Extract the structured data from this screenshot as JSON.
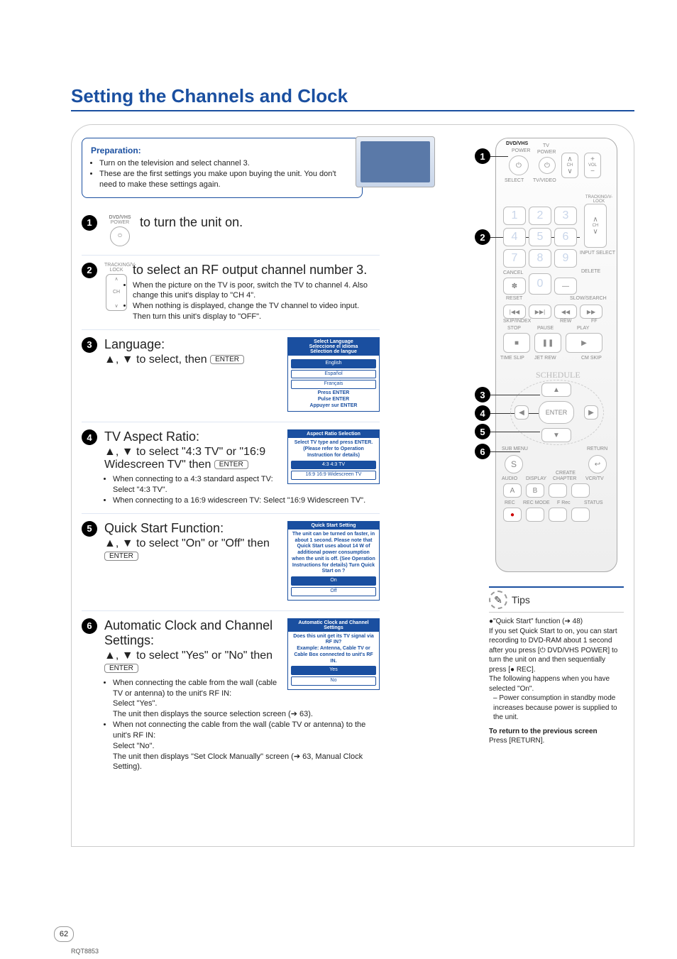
{
  "title": "Setting the Channels and Clock",
  "prep": {
    "heading": "Preparation:",
    "items": [
      "Turn on the television and select channel 3.",
      "These are the first settings you make upon buying the unit. You don't need to make these settings again."
    ]
  },
  "step1": {
    "labelTop": "DVD/VHS",
    "labelPower": "POWER",
    "text": "to turn the unit on."
  },
  "step2": {
    "labelTop": "TRACKING/V-LOCK",
    "chLabel": "CH",
    "text1": "to select an RF output channel number 3.",
    "b1": "When the picture on the TV is poor, switch the TV to channel 4. Also change this unit's display to \"CH 4\".",
    "b2": "When nothing is displayed, change the TV channel to video input. Then turn this unit's display to \"OFF\"."
  },
  "step3": {
    "title": "Language:",
    "text": " to select, then ",
    "enter": "ENTER",
    "osdHead": "Select Language\nSeleccione el idioma\nSélection de langue",
    "osdOpts": [
      "English",
      "Español",
      "Français"
    ],
    "osdFoot": "Press ENTER\nPulse ENTER\nAppuyer sur ENTER"
  },
  "step4": {
    "title": "TV Aspect Ratio:",
    "text": " to select \"4:3 TV\" or \"16:9 Widescreen TV\" then ",
    "enter": "ENTER",
    "b1": "When connecting to a 4:3 standard aspect TV: Select \"4:3 TV\".",
    "b2": "When connecting to a 16:9 widescreen TV: Select \"16:9 Widescreen TV\".",
    "osdHead": "Aspect Ratio Selection",
    "osdBody": "Select TV type  and press ENTER.\n(Please refer to Operation Instruction for details)",
    "osdOpts": [
      "4:3   4:3 TV",
      "16:9  16:9 Widescreen TV"
    ]
  },
  "step5": {
    "title": "Quick Start Function:",
    "text": " to select \"On\" or \"Off\"  then ",
    "enter": "ENTER",
    "osdHead": "Quick Start Setting",
    "osdBody": "The unit can be turned on faster, in about 1 second. Please note that Quick Start uses about 14 W of additional power consumption when the unit is off. (See Operation Instructions for details) Turn Quick Start on ?",
    "osdOpts": [
      "On",
      "Off"
    ]
  },
  "step6": {
    "title": "Automatic Clock and Channel Settings:",
    "text": " to select \"Yes\" or \"No\" then ",
    "enter": "ENTER",
    "b1": "When connecting the cable from the wall (cable TV or antenna) to the unit's RF IN:\nSelect \"Yes\".\nThe unit then displays the source selection screen (➔ 63).",
    "b2": "When not connecting the cable from the wall (cable TV or antenna) to the unit's RF IN:\nSelect \"No\".\nThe unit then displays \"Set Clock Manually\" screen (➔ 63, Manual Clock Setting).",
    "osdHead": "Automatic Clock and Channel Settings",
    "osdBody": "Does this unit get its TV signal via RF IN?\nExample: Antenna, Cable TV or Cable Box connected to unit's RF IN.",
    "osdOpts": [
      "Yes",
      "No"
    ]
  },
  "tips": {
    "title": "Tips",
    "b1": "\"Quick Start\" function (➔ 48)\nIf you set Quick Start to on, you can start recording to DVD-RAM about 1 second after you press [⏻ DVD/VHS POWER] to turn the unit on and then sequentially press [● REC].\nThe following happens when you have selected \"On\".",
    "sub1": "– Power consumption in standby mode increases because power is supplied to the unit.",
    "ret": "To return to the previous screen",
    "retBody": "Press [RETURN]."
  },
  "remote": {
    "dvdvhs": "DVD/VHS",
    "power": "POWER",
    "tv": "TV",
    "tvpower": "POWER",
    "dvdvhsTvLabel": "DVD/VHS  TV",
    "select": "SELECT",
    "tvvideo": "TV/VIDEO",
    "ch": "CH",
    "vol": "VOL",
    "track": "TRACKING/V-LOCK",
    "inputsel": "INPUT SELECT",
    "cancel": "CANCEL",
    "reset": "RESET",
    "delete": "DELETE",
    "slow": "SLOW/SEARCH",
    "skip": "SKIP/INDEX",
    "rew": "REW",
    "ff": "FF",
    "stop": "STOP",
    "pause": "PAUSE",
    "play": "PLAY",
    "timeslip": "TIME SLIP",
    "jetrew": "JET REW",
    "cmskip": "CM SKIP",
    "schedule": "SCHEDULE",
    "enter": "ENTER",
    "submenu": "SUB MENU",
    "return": "RETURN",
    "audio": "AUDIO",
    "display": "DISPLAY",
    "chapter": "CHAPTER",
    "create": "CREATE",
    "vcritv": "VCR/TV",
    "rec": "REC",
    "recmode": "REC MODE",
    "frec": "F Rec",
    "status": "STATUS",
    "num": [
      "1",
      "2",
      "3",
      "4",
      "5",
      "6",
      "7",
      "8",
      "9",
      "0"
    ],
    "ast": "✽",
    "dash": "—",
    "s": "S",
    "a": "A",
    "b": "B"
  },
  "pageNumber": "62",
  "docCode": "RQT8853"
}
